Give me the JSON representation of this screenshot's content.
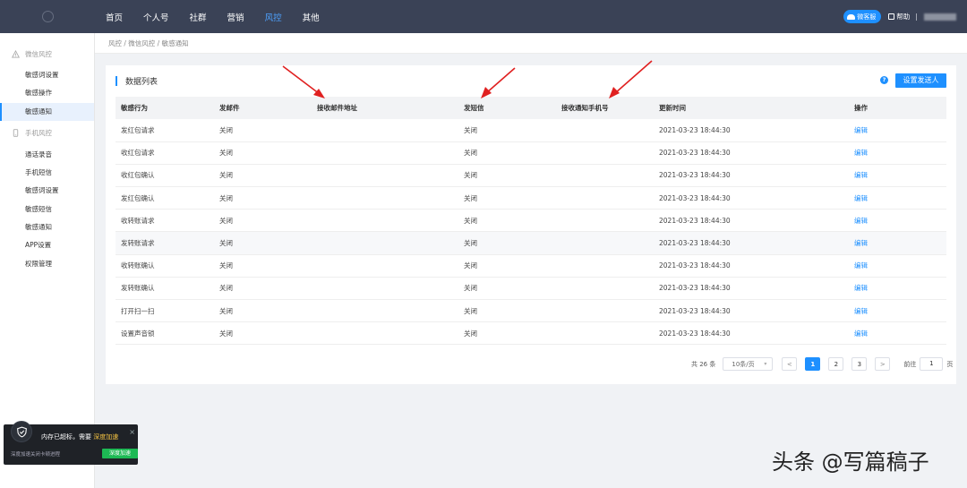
{
  "topnav": {
    "items": [
      {
        "label": "首页",
        "active": false
      },
      {
        "label": "个人号",
        "active": false
      },
      {
        "label": "社群",
        "active": false
      },
      {
        "label": "营销",
        "active": false
      },
      {
        "label": "风控",
        "active": true
      },
      {
        "label": "其他",
        "active": false
      }
    ],
    "service_label": "微客服",
    "help_label": "帮助",
    "separator": "|"
  },
  "sidebar": {
    "groups": [
      {
        "label": "微信风控",
        "icon": "warning-icon",
        "items": [
          {
            "label": "敏感词设置",
            "active": false
          },
          {
            "label": "敏感操作",
            "active": false
          },
          {
            "label": "敏感通知",
            "active": true
          }
        ]
      },
      {
        "label": "手机风控",
        "icon": "phone-icon",
        "items": [
          {
            "label": "通话录音",
            "active": false
          },
          {
            "label": "手机短信",
            "active": false
          },
          {
            "label": "敏感词设置",
            "active": false
          },
          {
            "label": "敏感短信",
            "active": false
          },
          {
            "label": "敏感通知",
            "active": false
          },
          {
            "label": "APP设置",
            "active": false
          },
          {
            "label": "权限管理",
            "active": false
          }
        ]
      }
    ]
  },
  "breadcrumb": "风控 / 微信风控 / 敏感通知",
  "card": {
    "title": "数据列表",
    "help_icon_glyph": "?",
    "set_button_label": "设置发送人"
  },
  "table": {
    "columns": [
      "敏感行为",
      "发邮件",
      "接收邮件地址",
      "发短信",
      "接收通知手机号",
      "更新时间",
      "操作"
    ],
    "rows": [
      [
        "发红包请求",
        "关闭",
        "",
        "关闭",
        "",
        "2021-03-23 18:44:30",
        "编辑"
      ],
      [
        "收红包请求",
        "关闭",
        "",
        "关闭",
        "",
        "2021-03-23 18:44:30",
        "编辑"
      ],
      [
        "收红包确认",
        "关闭",
        "",
        "关闭",
        "",
        "2021-03-23 18:44:30",
        "编辑"
      ],
      [
        "发红包确认",
        "关闭",
        "",
        "关闭",
        "",
        "2021-03-23 18:44:30",
        "编辑"
      ],
      [
        "收转账请求",
        "关闭",
        "",
        "关闭",
        "",
        "2021-03-23 18:44:30",
        "编辑"
      ],
      [
        "发转账请求",
        "关闭",
        "",
        "关闭",
        "",
        "2021-03-23 18:44:30",
        "编辑"
      ],
      [
        "收转账确认",
        "关闭",
        "",
        "关闭",
        "",
        "2021-03-23 18:44:30",
        "编辑"
      ],
      [
        "发转账确认",
        "关闭",
        "",
        "关闭",
        "",
        "2021-03-23 18:44:30",
        "编辑"
      ],
      [
        "打开扫一扫",
        "关闭",
        "",
        "关闭",
        "",
        "2021-03-23 18:44:30",
        "编辑"
      ],
      [
        "设置声音锁",
        "关闭",
        "",
        "关闭",
        "",
        "2021-03-23 18:44:30",
        "编辑"
      ]
    ]
  },
  "pagination": {
    "total_text": "共 26 条",
    "page_size": "10条/页",
    "prev": "<",
    "next": ">",
    "pages": [
      "1",
      "2",
      "3"
    ],
    "current": "1",
    "goto_prefix": "前往",
    "goto_value": "1",
    "goto_suffix": "页"
  },
  "toast": {
    "message_prefix": "内存已超标，需要 ",
    "message_highlight": "深度加速",
    "subtitle": "深度加速关闭卡顿进程",
    "button": "深度加速",
    "close": "×"
  },
  "watermark": "头条 @写篇稿子",
  "colors": {
    "topbar": "#3a4256",
    "accent": "#1e90ff",
    "annotation_arrow": "#e02020"
  }
}
